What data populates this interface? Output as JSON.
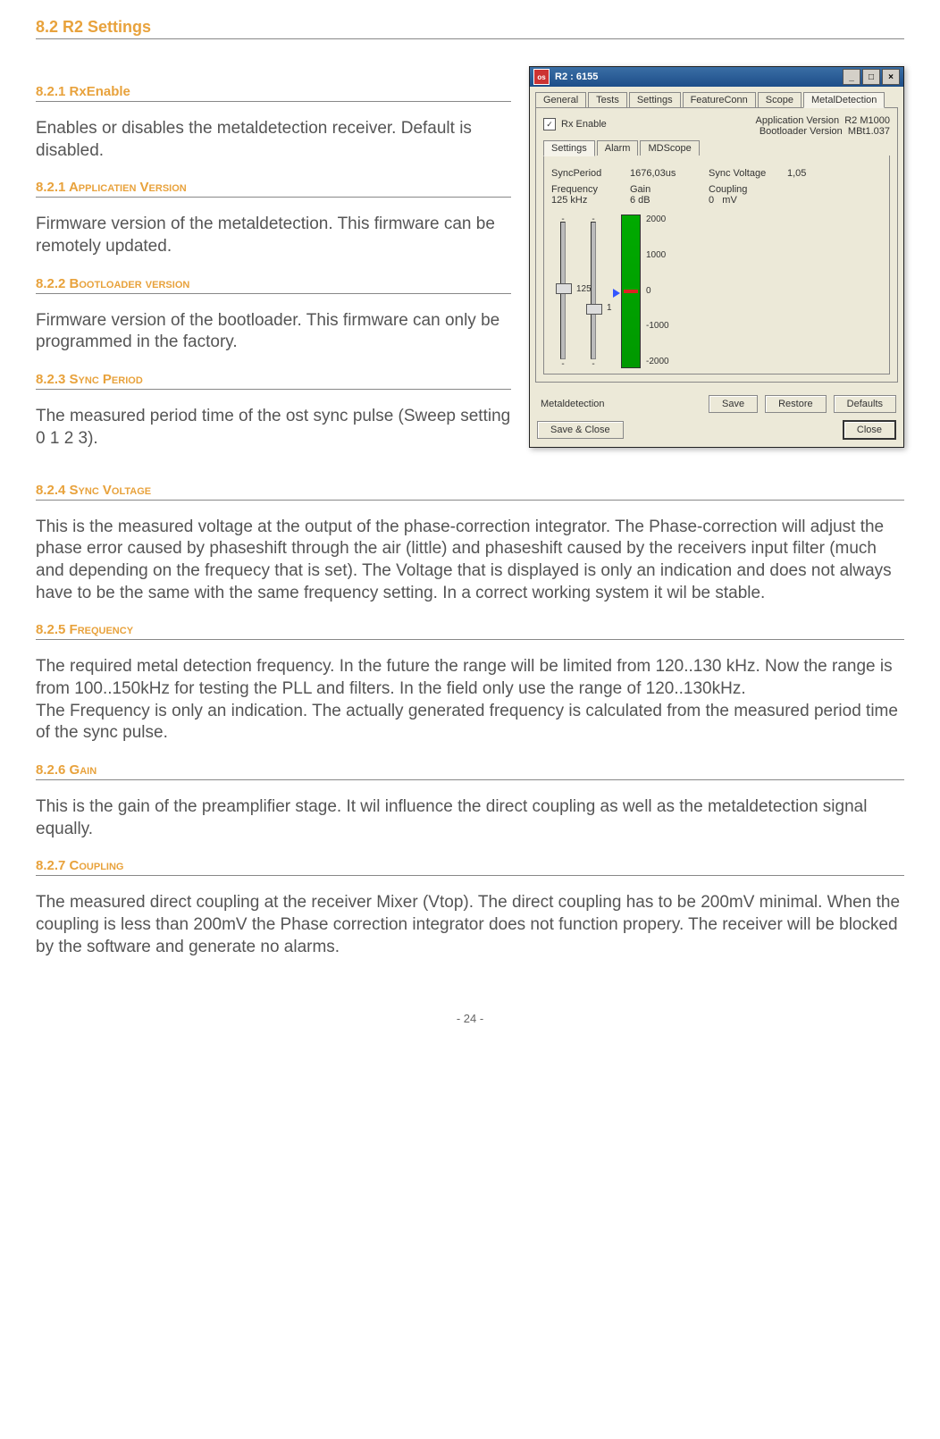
{
  "section_title": "8.2 R2 Settings",
  "s821": {
    "title": "8.2.1 RxEnable",
    "text": "Enables or disables the metaldetection receiver. Default is disabled."
  },
  "s821b": {
    "title": "8.2.1 Applicatien Version",
    "text": "Firmware version of the metaldetection. This firmware can be remotely updated."
  },
  "s822": {
    "title": "8.2.2 Bootloader version",
    "text": "Firmware version of the bootloader. This firmware can only be programmed in the factory."
  },
  "s823": {
    "title": "8.2.3 Sync Period",
    "text": "The measured period time of the ost sync pulse (Sweep setting 0 1 2 3)."
  },
  "s824": {
    "title": "8.2.4 Sync Voltage",
    "text": "This is the measured voltage at the output of the phase-correction integrator. The Phase-correction will adjust the phase error caused by phaseshift through the air (little) and phaseshift caused by the receivers input filter (much and depending on the frequecy that is set). The Voltage that is displayed is only an indication and does not always have to be the same with the same frequency setting. In a correct working system it wil be stable."
  },
  "s825": {
    "title": "8.2.5 Frequency",
    "text": "The required metal detection frequency. In the future the range will be limited from 120..130 kHz. Now the range is from 100..150kHz for testing the PLL and filters. In the field only use the range of 120..130kHz.\nThe Frequency is only an indication. The actually generated frequency is calculated from the measured period time of the sync pulse."
  },
  "s826": {
    "title": "8.2.6 Gain",
    "text": "This is the gain of the preamplifier stage. It wil influence the direct coupling as well as the metaldetection signal equally."
  },
  "s827": {
    "title": "8.2.7 Coupling",
    "text": "The measured direct coupling at the receiver Mixer (Vtop). The direct coupling has to be 200mV minimal. When the coupling is less than 200mV the Phase correction integrator does not function propery. The receiver will be blocked by the software and generate no alarms."
  },
  "page_number": "-  24 -",
  "window": {
    "title": "R2 : 6155",
    "min": "_",
    "max": "□",
    "close": "×",
    "main_tabs": [
      "General",
      "Tests",
      "Settings",
      "FeatureConn",
      "Scope",
      "MetalDetection"
    ],
    "rx_enable_label": "Rx Enable",
    "rx_enable_checked": "✓",
    "app_ver_label": "Application Version",
    "app_ver_value": "R2 M1000",
    "boot_ver_label": "Bootloader Version",
    "boot_ver_value": "MBt1.037",
    "sub_tabs": [
      "Settings",
      "Alarm",
      "MDScope"
    ],
    "sync_period_label": "SyncPeriod",
    "sync_period_value": "1676,03us",
    "sync_voltage_label": "Sync Voltage",
    "sync_voltage_value": "1,05",
    "freq_label": "Frequency",
    "freq_value": "125 kHz",
    "gain_label": "Gain",
    "gain_value": "6 dB",
    "coupling_label": "Coupling",
    "coupling_value": "0",
    "coupling_unit": "mV",
    "slider_freq_tick": "125",
    "slider_gain_tick": "1",
    "scale": {
      "v2000": "2000",
      "v1000": "1000",
      "v0": "0",
      "vm1000": "-1000",
      "vm2000": "-2000"
    },
    "status_label": "Metaldetection",
    "btn_save": "Save",
    "btn_restore": "Restore",
    "btn_defaults": "Defaults",
    "btn_save_close": "Save & Close",
    "btn_close": "Close"
  }
}
